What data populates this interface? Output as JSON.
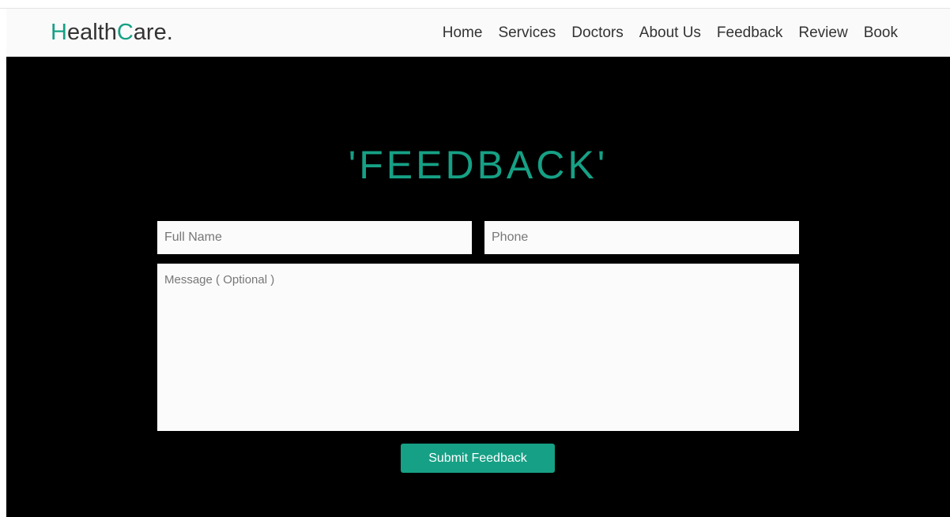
{
  "header": {
    "logo_first_letter": "H",
    "logo_mid": "ealth",
    "logo_second_letter": "C",
    "logo_end": "are.",
    "nav_items": [
      {
        "label": "Home"
      },
      {
        "label": "Services"
      },
      {
        "label": "Doctors"
      },
      {
        "label": "About Us"
      },
      {
        "label": "Feedback"
      },
      {
        "label": "Review"
      },
      {
        "label": "Book"
      }
    ]
  },
  "feedback": {
    "heading": "'FEEDBACK'",
    "full_name_placeholder": "Full Name",
    "phone_placeholder": "Phone",
    "message_placeholder": "Message ( Optional )",
    "submit_label": "Submit Feedback"
  },
  "colors": {
    "accent": "#16a085",
    "background": "#000000",
    "navbar": "#fafafa"
  }
}
